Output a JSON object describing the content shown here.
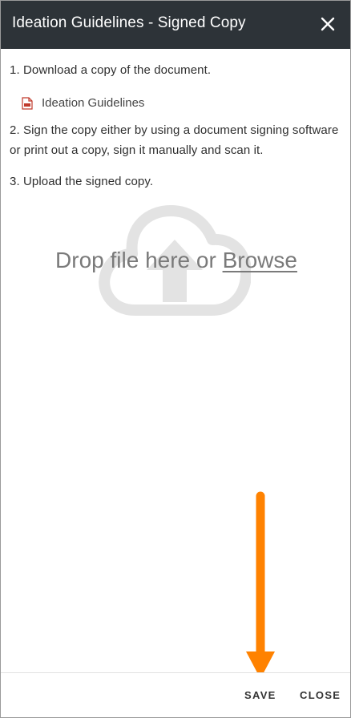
{
  "header": {
    "title": "Ideation Guidelines - Signed Copy",
    "close_icon": "close-icon"
  },
  "steps": {
    "step1": "1. Download a copy of the document.",
    "step2": "2. Sign the copy either by using a document signing software or print out a copy, sign it manually and scan it.",
    "step3": "3. Upload the signed copy."
  },
  "document": {
    "label": "Ideation Guidelines",
    "icon": "pdf-file-icon"
  },
  "upload": {
    "icon": "cloud-upload-icon",
    "drop_text": "Drop file here or ",
    "browse_label": "Browse"
  },
  "footer": {
    "save_label": "SAVE",
    "close_label": "CLOSE"
  },
  "annotation": {
    "icon": "down-arrow-icon",
    "color": "#ff8200"
  },
  "colors": {
    "header_bg": "#2d3338",
    "pdf_red": "#c0392b",
    "cloud_gray": "#e3e3e3"
  }
}
